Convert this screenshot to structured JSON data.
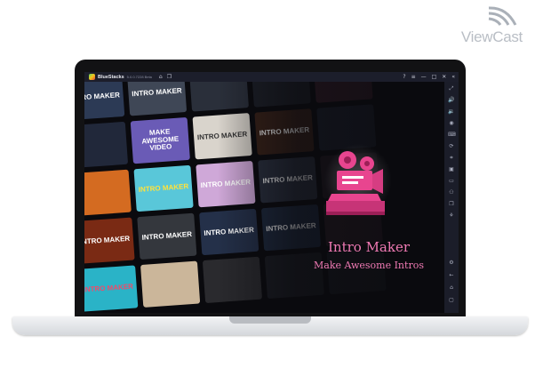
{
  "watermark": {
    "text": "ViewCast"
  },
  "app": {
    "name": "BlueStacks",
    "version": "5.0.0.7228 Beta",
    "window_controls": [
      "?",
      "≡",
      "—",
      "□",
      "✕",
      "«"
    ]
  },
  "banner": {
    "title": "Intro Maker",
    "subtitle": "Make Awesome Intros",
    "accent": "#f07ab4",
    "logo_color": "#e8458f"
  },
  "tiles": [
    {
      "text": "INTRO MAKER",
      "bg": "#2c3a55",
      "fg": "#ffffff"
    },
    {
      "text": "INTRO MAKER",
      "bg": "#3f4756",
      "fg": "#ffffff"
    },
    {
      "text": "",
      "bg": "#2a2f3a",
      "fg": "#ffffff"
    },
    {
      "text": "",
      "bg": "#1c1f27",
      "fg": "#ffffff"
    },
    {
      "text": "",
      "bg": "#3a1f2b",
      "fg": "#ffffff"
    },
    {
      "text": "",
      "bg": "#21283a",
      "fg": "#ffffff"
    },
    {
      "text": "MAKE AWESOME VIDEO",
      "bg": "#6a5bb6",
      "fg": "#ffffff"
    },
    {
      "text": "INTRO MAKER",
      "bg": "#d9d4cc",
      "fg": "#333333"
    },
    {
      "text": "INTRO MAKER",
      "bg": "#3a2218",
      "fg": "#ffffff"
    },
    {
      "text": "",
      "bg": "#1d2230",
      "fg": "#ffffff"
    },
    {
      "text": "",
      "bg": "#d46b21",
      "fg": "#ffffff"
    },
    {
      "text": "INTRO MAKER",
      "bg": "#59c7d9",
      "fg": "#ffe23b"
    },
    {
      "text": "INTRO MAKER",
      "bg": "#cfa8d8",
      "fg": "#ffffff"
    },
    {
      "text": "INTRO MAKER",
      "bg": "#2b3140",
      "fg": "#ffffff"
    },
    {
      "text": "",
      "bg": "#231a22",
      "fg": "#ffffff"
    },
    {
      "text": "INTRO MAKER",
      "bg": "#7a2a14",
      "fg": "#ffffff"
    },
    {
      "text": "INTRO MAKER",
      "bg": "#34373d",
      "fg": "#ffffff"
    },
    {
      "text": "INTRO MAKER",
      "bg": "#243049",
      "fg": "#ffffff"
    },
    {
      "text": "INTRO MAKER",
      "bg": "#1e2a3f",
      "fg": "#ffffff"
    },
    {
      "text": "",
      "bg": "#2b1d25",
      "fg": "#ffffff"
    },
    {
      "text": "INTRO MAKER",
      "bg": "#2ab3c7",
      "fg": "#f04a6a"
    },
    {
      "text": "",
      "bg": "#cbb69a",
      "fg": "#ffffff"
    },
    {
      "text": "",
      "bg": "#2a2a2e",
      "fg": "#ffffff"
    },
    {
      "text": "",
      "bg": "#1a1c22",
      "fg": "#ffffff"
    },
    {
      "text": "",
      "bg": "#181a20",
      "fg": "#ffffff"
    }
  ],
  "sidebar_icons": [
    "expand-icon",
    "volume-up-icon",
    "volume-down-icon",
    "screen-record-icon",
    "keyboard-icon",
    "rotate-icon",
    "screenshot-icon",
    "apk-icon",
    "folder-icon",
    "macro-icon",
    "multi-instance-icon",
    "eco-mode-icon",
    "settings-icon",
    "back-icon",
    "home-icon",
    "recent-apps-icon"
  ]
}
